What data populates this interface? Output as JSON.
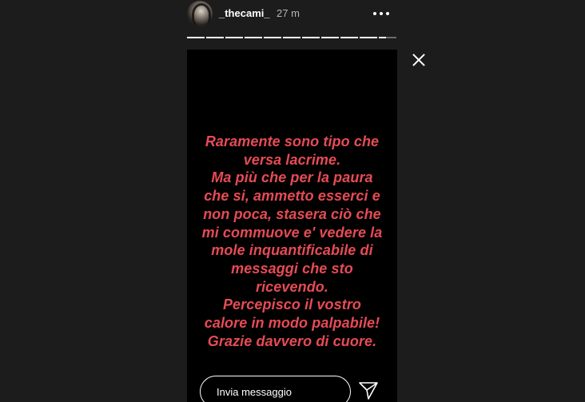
{
  "header": {
    "username": "_thecami_",
    "timestamp": "27 m"
  },
  "progress": {
    "segment_count": 11,
    "current_segment": 11,
    "current_fraction": 0.4
  },
  "story": {
    "text_color": "#e64b55",
    "lines": [
      "Raramente sono tipo che",
      "versa lacrime.",
      "Ma più che per la paura",
      "che si, ammetto esserci e",
      "non poca, stasera ciò che",
      "mi commuove e' vedere la",
      "mole inquantificabile di",
      "messaggi che sto",
      "ricevendo.",
      "Percepisco il vostro",
      "calore in modo palpabile!",
      "Grazie davvero di cuore."
    ]
  },
  "reply": {
    "placeholder": "Invia messaggio"
  },
  "icons": {
    "more": "more-options-icon",
    "close": "close-icon",
    "send": "send-icon"
  }
}
